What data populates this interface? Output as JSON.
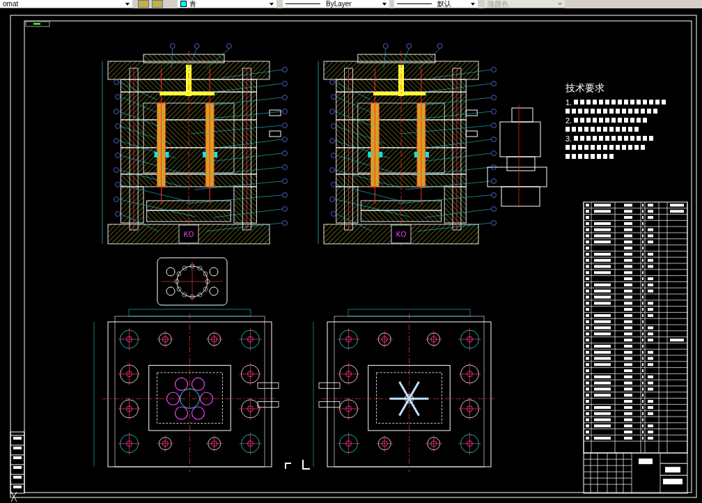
{
  "toolbar": {
    "dropdowns": [
      {
        "kind": "plain",
        "value": "omat",
        "disabled": false
      },
      {
        "kind": "swatch",
        "value": "青",
        "disabled": false
      },
      {
        "kind": "line",
        "value": "ByLayer",
        "disabled": false
      },
      {
        "kind": "line",
        "value": "默认",
        "disabled": false
      },
      {
        "kind": "plain",
        "value": "随颜色",
        "disabled": true
      }
    ]
  },
  "drawing": {
    "section_views": [
      {
        "ko_label": "KO"
      },
      {
        "ko_label": "KO"
      }
    ],
    "technical_requirements": {
      "title": "技术要求",
      "items": [
        {
          "number": "1."
        },
        {
          "number": "2."
        },
        {
          "number": "3."
        }
      ]
    }
  }
}
